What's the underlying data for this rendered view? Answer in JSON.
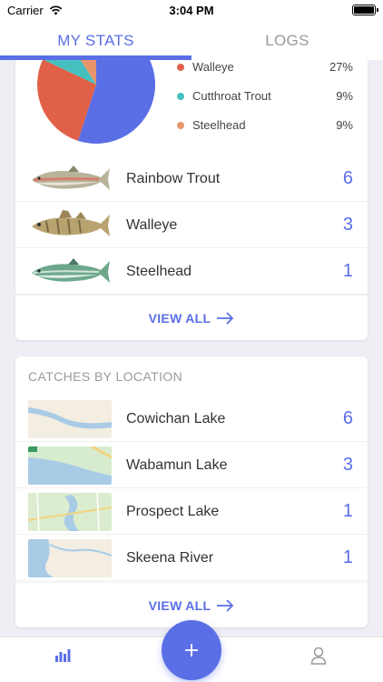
{
  "status_bar": {
    "carrier": "Carrier",
    "time": "3:04 PM"
  },
  "tabs": [
    {
      "label": "MY STATS",
      "active": true
    },
    {
      "label": "LOGS",
      "active": false
    }
  ],
  "species_card": {
    "chart_data": {
      "type": "pie",
      "slices": [
        {
          "name": "Rainbow Trout",
          "value": 55,
          "color": "#5a6ee6"
        },
        {
          "name": "Walleye",
          "value": 27,
          "color": "#e06048"
        },
        {
          "name": "Cutthroat Trout",
          "value": 9,
          "color": "#46c0be"
        },
        {
          "name": "Steelhead",
          "value": 9,
          "color": "#e8956c"
        }
      ]
    },
    "legend": [
      {
        "name": "Walleye",
        "pct": "27%",
        "color": "#e06048"
      },
      {
        "name": "Cutthroat Trout",
        "pct": "9%",
        "color": "#46c0be"
      },
      {
        "name": "Steelhead",
        "pct": "9%",
        "color": "#e8956c"
      }
    ],
    "rows": [
      {
        "name": "Rainbow Trout",
        "count": "6",
        "icon": "rainbow-trout-fish-image"
      },
      {
        "name": "Walleye",
        "count": "3",
        "icon": "walleye-fish-image"
      },
      {
        "name": "Steelhead",
        "count": "1",
        "icon": "steelhead-fish-image"
      }
    ],
    "view_all": "VIEW ALL"
  },
  "location_card": {
    "title": "CATCHES BY LOCATION",
    "rows": [
      {
        "name": "Cowichan Lake",
        "count": "6",
        "icon": "map-thumbnail"
      },
      {
        "name": "Wabamun Lake",
        "count": "3",
        "icon": "map-thumbnail"
      },
      {
        "name": "Prospect Lake",
        "count": "1",
        "icon": "map-thumbnail"
      },
      {
        "name": "Skeena River",
        "count": "1",
        "icon": "map-thumbnail"
      }
    ],
    "view_all": "VIEW ALL"
  },
  "bottom_nav": {
    "stats_icon": "bar-chart-icon",
    "add_icon": "plus-icon",
    "profile_icon": "person-icon"
  },
  "colors": {
    "accent": "#5a6ee6",
    "background": "#eeeef4"
  }
}
